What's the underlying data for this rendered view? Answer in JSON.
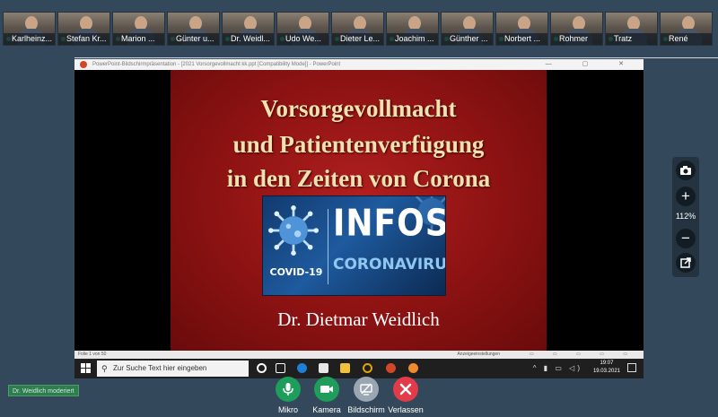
{
  "participants": [
    {
      "name": "Karlheinz..."
    },
    {
      "name": "Stefan Kr..."
    },
    {
      "name": "Marion ..."
    },
    {
      "name": "Günter u..."
    },
    {
      "name": "Dr. Weidl..."
    },
    {
      "name": "Udo We..."
    },
    {
      "name": "Dieter Le..."
    },
    {
      "name": "Joachim ..."
    },
    {
      "name": "Günther ..."
    },
    {
      "name": "Norbert ..."
    },
    {
      "name": "Rohmer"
    },
    {
      "name": "Tratz"
    },
    {
      "name": "René"
    }
  ],
  "share_window": {
    "title": "PowerPoint-Bildschirmpräsentation - [2021 Vorsorgevollmacht kk.ppt [Compatibility Mode]] - PowerPoint",
    "controls": "— ▢ ✕",
    "slide": {
      "title_line1": "Vorsorgevollmacht",
      "title_line2": "und Patientenverfügung",
      "title_line3": "in den Zeiten von Corona",
      "image_word_infos": "INFOS",
      "image_word_coronavirus": "CORONAVIRUS",
      "image_word_covid": "COVID-19",
      "author": "Dr. Dietmar Weidlich"
    },
    "status_bar": {
      "slide_counter": "Folie 1 von 50",
      "display_settings": "Anzeigeeinstellungen",
      "view_icons": "▭ ▭ ▭ ▭ ▭"
    },
    "taskbar": {
      "search_placeholder": "Zur Suche Text hier eingeben",
      "search_icon": "search-icon",
      "tray_icons": "^ ▮ ▭ ◁)",
      "time": "19:07",
      "date": "19.03.2021"
    }
  },
  "zoom": {
    "level": "112%",
    "zoom_in": "+",
    "zoom_out": "−"
  },
  "moderator_badge": "Dr. Weidlich moderiert",
  "controls": {
    "mic_label": "Mikro",
    "camera_label": "Kamera",
    "screen_label": "Bildschirm",
    "leave_label": "Verlassen"
  },
  "colors": {
    "background": "#33485a",
    "slide_red": "#8c1212",
    "slide_title": "#efe2b0",
    "green_button": "#1e9e5a",
    "leave_button": "#e23b4a",
    "screen_button": "#9aa6b2"
  }
}
